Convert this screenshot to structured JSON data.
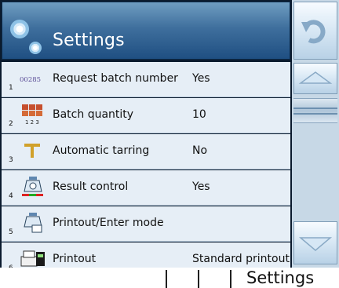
{
  "header": {
    "title": "Settings"
  },
  "rows": [
    {
      "num": "1",
      "label": "Request batch number",
      "value": "Yes",
      "icon": "batch-number-icon",
      "icon_text": "00285"
    },
    {
      "num": "2",
      "label": "Batch quantity",
      "value": "10",
      "icon": "batch-quantity-icon",
      "icon_text": "1 2 3"
    },
    {
      "num": "3",
      "label": "Automatic tarring",
      "value": "No",
      "icon": "tare-icon"
    },
    {
      "num": "4",
      "label": "Result control",
      "value": "Yes",
      "icon": "scale-result-icon"
    },
    {
      "num": "5",
      "label": "Printout/Enter mode",
      "value": "",
      "icon": "scale-printout-icon"
    },
    {
      "num": "6",
      "label": "Printout",
      "value": "Standard printout",
      "icon": "printer-icon"
    }
  ],
  "status": {
    "title": "Settings"
  },
  "icons": {
    "back": "back-arrow-icon",
    "up": "up-arrow-icon",
    "down": "down-arrow-icon"
  }
}
